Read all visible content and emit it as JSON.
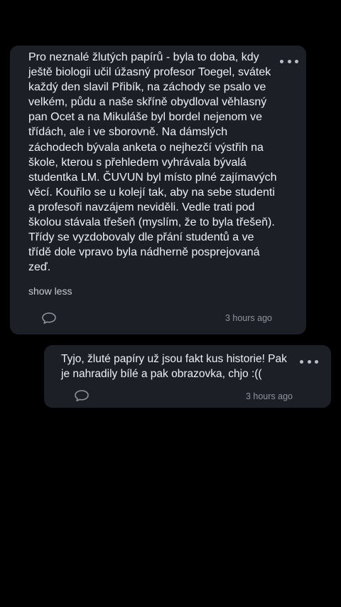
{
  "comments": [
    {
      "text": "Pro neznalé žlutých papírů - byla to doba, kdy ještě biologii učil úžasný profesor Toegel, svátek každý den slavil Přibík, na záchody se psalo ve velkém, půdu a naše skříně obydloval věhlasný pan Ocet a na Mikuláše byl bordel nejenom ve třídách, ale i ve sborovně. Na dámslých záchodech bývala anketa o nejhezčí výstřih na škole, kterou s přehledem vyhrávala bývalá studentka LM. ČUVUN byl místo plné zajímavých věcí. Kouřilo se u kolejí tak, aby na sebe studenti a profesoři navzájem neviděli. Vedle trati pod školou stávala třešeň (myslím, že to byla třešeň). Třídy se vyzdobovaly dle přání studentů a ve třídě dole vpravo byla nádherně posprejovaná zeď.",
      "toggle_label": "show less",
      "timestamp": "3 hours ago",
      "more_icon": "more-horizontal-icon",
      "reply_icon": "speech-bubble-icon"
    },
    {
      "text": "Tyjo, žluté papíry už jsou fakt kus historie! Pak je nahradily bílé a pak obrazovka, chjo :((",
      "timestamp": "3 hours ago",
      "more_icon": "more-horizontal-icon",
      "reply_icon": "speech-bubble-icon"
    }
  ],
  "colors": {
    "background": "#000000",
    "card": "#1c1f26",
    "text": "#eef0f5",
    "muted": "#8e939d"
  }
}
